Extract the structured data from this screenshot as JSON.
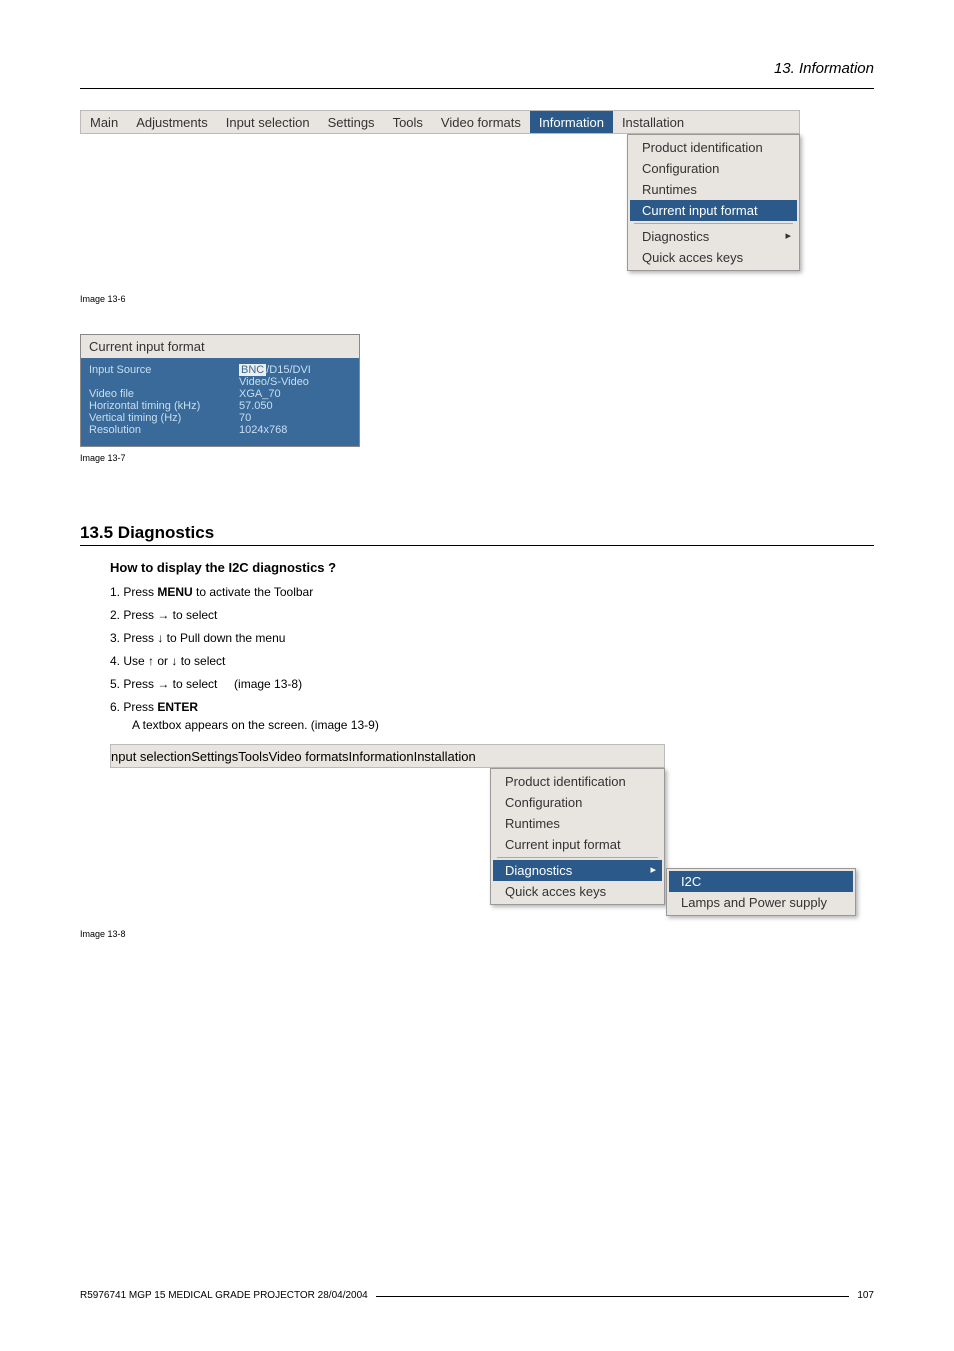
{
  "header": {
    "chapter": "13.  Information"
  },
  "fig1": {
    "menubar": {
      "main": "Main",
      "adjustments": "Adjustments",
      "input_selection": "Input selection",
      "settings": "Settings",
      "tools": "Tools",
      "video_formats": "Video formats",
      "information": "Information",
      "installation": "Installation"
    },
    "dropdown": {
      "product_identification": "Product identification",
      "configuration": "Configuration",
      "runtimes": "Runtimes",
      "current_input_format": "Current input format",
      "diagnostics": "Diagnostics",
      "quick_access": "Quick acces keys"
    },
    "caption": "Image 13-6"
  },
  "cif": {
    "title": "Current input format",
    "rows": {
      "input_source_label": "Input Source",
      "input_source_value_hl": "BNC",
      "input_source_value_rest": "/D15/DVI",
      "input_source_value_line2": "Video/S-Video",
      "video_file_label": "Video file",
      "video_file_value": "XGA_70",
      "htiming_label": "Horizontal timing (kHz)",
      "htiming_value": "57.050",
      "vtiming_label": "Vertical timing (Hz)",
      "vtiming_value": "70",
      "resolution_label": "Resolution",
      "resolution_value": "1024x768"
    },
    "caption": "Image 13-7"
  },
  "section": {
    "heading": "13.5 Diagnostics",
    "subheading": "How to display the I2C diagnostics ?",
    "steps": {
      "s1a": "Press ",
      "s1b": "MENU",
      "s1c": " to activate the Toolbar",
      "s2": "Press → to select",
      "s3": "Press ↓ to Pull down the menu",
      "s4": "Use ↑ or ↓ to select",
      "s5a": "Press → to select",
      "s5b": "(image 13-8)",
      "s6a": "Press ",
      "s6b": "ENTER",
      "s6note": "A textbox appears on the screen. (image 13-9)"
    }
  },
  "fig2": {
    "menubar": {
      "input_selection": "nput selection",
      "settings": "Settings",
      "tools": "Tools",
      "video_formats": "Video formats",
      "information": "Information",
      "installation": "Installation"
    },
    "dropdown": {
      "product_identification": "Product identification",
      "configuration": "Configuration",
      "runtimes": "Runtimes",
      "current_input_format": "Current input format",
      "diagnostics": "Diagnostics",
      "quick_access": "Quick acces keys"
    },
    "submenu": {
      "i2c": "I2C",
      "lamps": "Lamps and Power supply"
    },
    "caption": "Image 13-8"
  },
  "footer": {
    "left": "R5976741  MGP 15 MEDICAL GRADE PROJECTOR  28/04/2004",
    "page": "107"
  }
}
